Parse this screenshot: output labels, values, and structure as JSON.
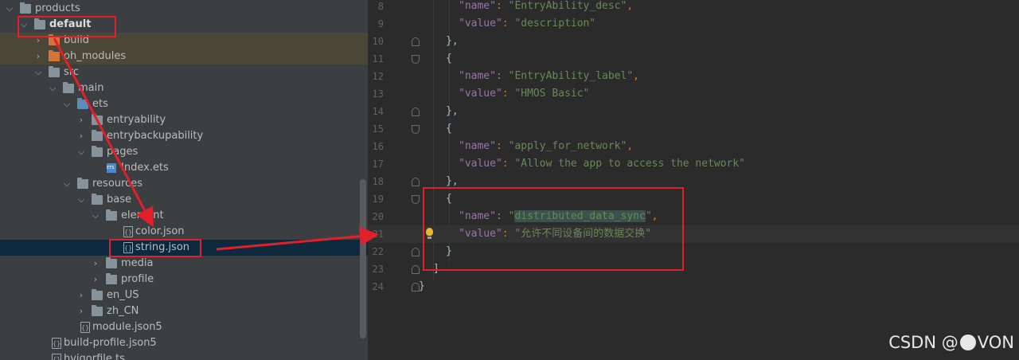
{
  "tree": {
    "rows": [
      {
        "label": "products",
        "type": "folder"
      },
      {
        "label": "default",
        "type": "module"
      },
      {
        "label": "build",
        "type": "folder-orange"
      },
      {
        "label": "oh_modules",
        "type": "folder-orange"
      },
      {
        "label": "src",
        "type": "folder"
      },
      {
        "label": "main",
        "type": "folder"
      },
      {
        "label": "ets",
        "type": "folder-blue"
      },
      {
        "label": "entryability",
        "type": "folder"
      },
      {
        "label": "entrybackupability",
        "type": "folder"
      },
      {
        "label": "pages",
        "type": "folder"
      },
      {
        "label": "Index.ets",
        "type": "ets-file"
      },
      {
        "label": "resources",
        "type": "folder"
      },
      {
        "label": "base",
        "type": "folder"
      },
      {
        "label": "element",
        "type": "folder"
      },
      {
        "label": "color.json",
        "type": "json-file"
      },
      {
        "label": "string.json",
        "type": "json-file"
      },
      {
        "label": "media",
        "type": "folder"
      },
      {
        "label": "profile",
        "type": "folder"
      },
      {
        "label": "en_US",
        "type": "folder"
      },
      {
        "label": "zh_CN",
        "type": "folder"
      },
      {
        "label": "module.json5",
        "type": "json-file"
      },
      {
        "label": "build-profile.json5",
        "type": "json-file"
      },
      {
        "label": "hvigorfile.ts",
        "type": "ts-file"
      }
    ]
  },
  "editor": {
    "lines": [
      {
        "n": "8",
        "key": "name",
        "val": "EntryAbility_desc",
        "trail": ","
      },
      {
        "n": "9",
        "key": "value",
        "val": "description",
        "trail": ""
      },
      {
        "n": "10",
        "text": "},"
      },
      {
        "n": "11",
        "text": "{"
      },
      {
        "n": "12",
        "key": "name",
        "val": "EntryAbility_label",
        "trail": ","
      },
      {
        "n": "13",
        "key": "value",
        "val": "HMOS Basic",
        "trail": ""
      },
      {
        "n": "14",
        "text": "},"
      },
      {
        "n": "15",
        "text": "{"
      },
      {
        "n": "16",
        "key": "name",
        "val": "apply_for_network",
        "trail": ","
      },
      {
        "n": "17",
        "key": "value",
        "val": "Allow the app to access the network",
        "trail": ""
      },
      {
        "n": "18",
        "text": "},"
      },
      {
        "n": "19",
        "text": "{"
      },
      {
        "n": "20",
        "key": "name",
        "val": "distributed_data_sync",
        "trail": ","
      },
      {
        "n": "21",
        "key": "value",
        "val": "允许不同设备间的数据交换",
        "trail": ""
      },
      {
        "n": "22",
        "text": "}"
      },
      {
        "n": "23",
        "text": "]"
      },
      {
        "n": "24",
        "text": "}"
      }
    ]
  },
  "watermark": {
    "prefix": "CSDN @",
    "suffix": "VON"
  },
  "colors": {
    "annotation": "#e0202a",
    "selection": "#0d293e",
    "string": "#6a8759",
    "key": "#9876aa"
  }
}
